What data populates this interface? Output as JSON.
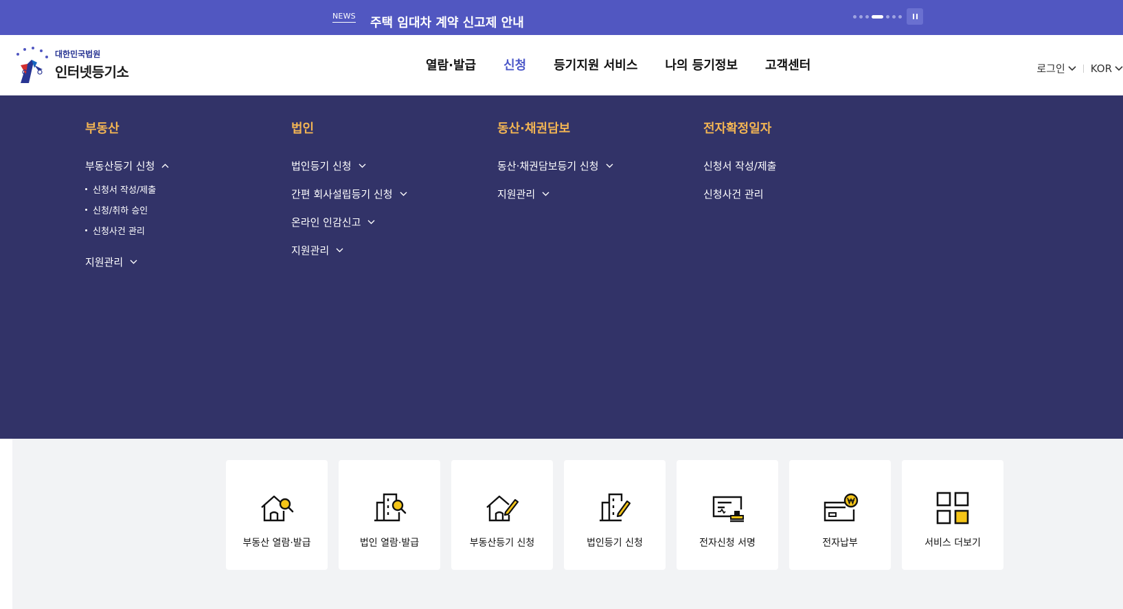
{
  "news": {
    "tag": "NEWS",
    "headline": "주택 임대차 계약 신고제 안내",
    "pause_icon": "pause-icon"
  },
  "logo": {
    "small": "대한민국법원",
    "big": "인터넷등기소"
  },
  "gnb": [
    "열람·발급",
    "신청",
    "등기지원 서비스",
    "나의 등기정보",
    "고객센터"
  ],
  "util": {
    "login": "로그인",
    "lang": "KOR"
  },
  "mega": {
    "col1": {
      "title": "부동산",
      "item1": "부동산등기 신청",
      "subs": [
        "신청서 작성/제출",
        "신청/취하 승인",
        "신청사건 관리"
      ],
      "item2": "지원관리"
    },
    "col2": {
      "title": "법인",
      "items": [
        "법인등기 신청",
        "간편 회사설립등기 신청",
        "온라인 인감신고",
        "지원관리"
      ]
    },
    "col3": {
      "title": "동산·채권담보",
      "items": [
        "동산·채권담보등기 신청",
        "지원관리"
      ]
    },
    "col4": {
      "title": "전자확정일자",
      "items": [
        "신청서 작성/제출",
        "신청사건 관리"
      ]
    }
  },
  "quick": [
    {
      "label": "부동산 열람·발급",
      "icon": "house-search-icon"
    },
    {
      "label": "법인 열람·발급",
      "icon": "building-search-icon"
    },
    {
      "label": "부동산등기 신청",
      "icon": "house-pen-icon"
    },
    {
      "label": "법인등기 신청",
      "icon": "building-pen-icon"
    },
    {
      "label": "전자신청 서명",
      "icon": "certificate-stamp-icon"
    },
    {
      "label": "전자납부",
      "icon": "card-won-icon"
    },
    {
      "label": "서비스 더보기",
      "icon": "grid-icon"
    }
  ],
  "colors": {
    "newsbar": "#5157c1",
    "mega_bg": "#323368",
    "accent_gold": "#f3b553",
    "active_nav": "#4b57c8",
    "icon_yellow": "#f5c518"
  }
}
